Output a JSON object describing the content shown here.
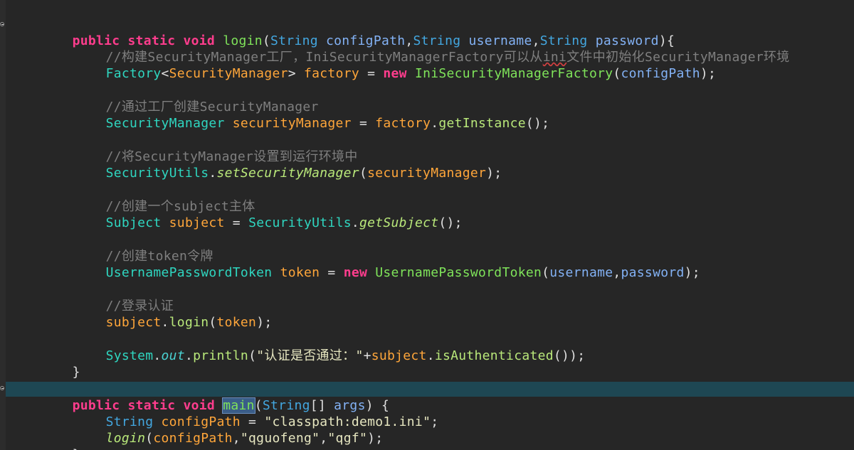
{
  "editor": {
    "lines": [
      [
        "public",
        " ",
        "static",
        " ",
        "void",
        " ",
        "login",
        "(",
        "String",
        " ",
        "configPath",
        ",",
        "String",
        " ",
        "username",
        ",",
        "String",
        " ",
        "password",
        "){"
      ],
      [
        "//构建SecurityManager工厂，IniSecurityManagerFactory可以从",
        "ini",
        "文件中初始化SecurityManager环境"
      ],
      [
        "Factory",
        "<",
        "SecurityManager",
        "> ",
        "factory",
        " = ",
        "new",
        " ",
        "IniSecurityManagerFactory",
        "(",
        "configPath",
        ");"
      ],
      [],
      [
        "//通过工厂创建SecurityManager"
      ],
      [
        "SecurityManager",
        " ",
        "securityManager",
        " = ",
        "factory",
        ".",
        "getInstance",
        "();"
      ],
      [],
      [
        "//将SecurityManager设置到运行环境中"
      ],
      [
        "SecurityUtils",
        ".",
        "setSecurityManager",
        "(",
        "securityManager",
        ");"
      ],
      [],
      [
        "//创建一个subject主体"
      ],
      [
        "Subject",
        " ",
        "subject",
        " = ",
        "SecurityUtils",
        ".",
        "getSubject",
        "();"
      ],
      [],
      [
        "//创建token令牌"
      ],
      [
        "UsernamePasswordToken",
        " ",
        "token",
        " = ",
        "new",
        " ",
        "UsernamePasswordToken",
        "(",
        "username",
        ",",
        "password",
        ");"
      ],
      [],
      [
        "//登录认证"
      ],
      [
        "subject",
        ".",
        "login",
        "(",
        "token",
        ");"
      ],
      [],
      [
        "System",
        ".",
        "out",
        ".",
        "println",
        "(",
        "\"认证是否通过：\"",
        "+",
        "subject",
        ".",
        "isAuthenticated",
        "());"
      ],
      [
        "}"
      ],
      [],
      [
        "public",
        " ",
        "static",
        " ",
        "void",
        " ",
        "main",
        "(",
        "String",
        "[] ",
        "args",
        ") {"
      ],
      [
        "String",
        " ",
        "configPath",
        " = ",
        "\"classpath:demo1.ini\"",
        ";"
      ],
      [
        "login",
        "(",
        "configPath",
        ",",
        "\"qguofeng\"",
        ",",
        "\"qgf\"",
        ");"
      ],
      [
        "}"
      ]
    ],
    "highlighted_line_index": 22,
    "selected_word": "main"
  }
}
